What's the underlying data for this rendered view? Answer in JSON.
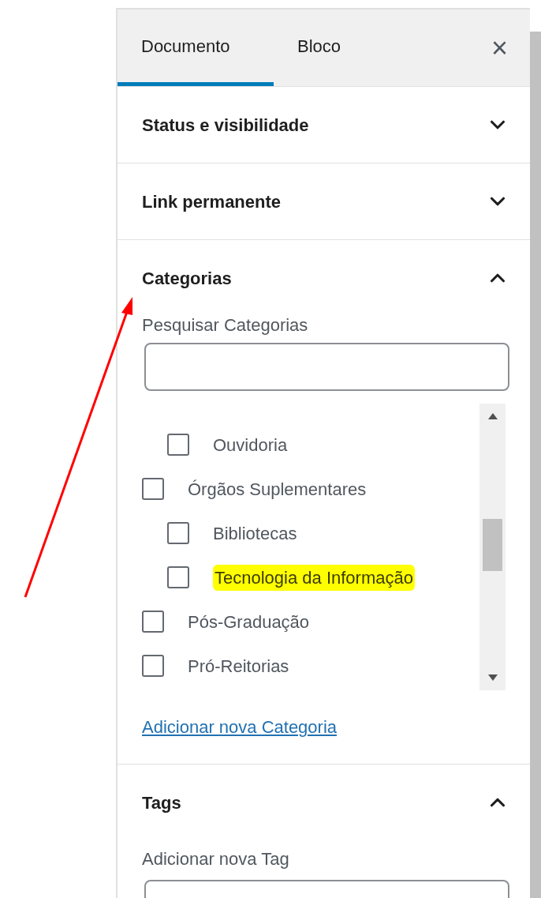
{
  "tabs": [
    {
      "label": "Documento",
      "selected": true
    },
    {
      "label": "Bloco",
      "selected": false
    }
  ],
  "close": "×",
  "panels": [
    {
      "title": "Status e visibilidade",
      "expanded": false
    },
    {
      "title": "Link permanente",
      "expanded": false
    },
    {
      "title": "Categorias",
      "expanded": true,
      "kind": "categories",
      "search_label": "Pesquisar Categorias",
      "items": [
        {
          "children": [
            {
              "label": "Ouvidoria",
              "checked": false,
              "highlighted": false
            }
          ]
        },
        {
          "label": "Órgãos Suplementares",
          "checked": false,
          "highlighted": false,
          "children": [
            {
              "label": "Bibliotecas",
              "checked": false,
              "highlighted": false
            },
            {
              "label": "Tecnologia da Informação",
              "checked": false,
              "highlighted": true
            }
          ]
        },
        {
          "label": "Pós-Graduação",
          "checked": false,
          "highlighted": false
        },
        {
          "label": "Pró-Reitorias",
          "checked": false,
          "highlighted": false
        }
      ],
      "add_link": "Adicionar nova Categoria"
    },
    {
      "title": "Tags",
      "expanded": true,
      "kind": "tags",
      "field_label": "Adicionar nova Tag"
    }
  ]
}
